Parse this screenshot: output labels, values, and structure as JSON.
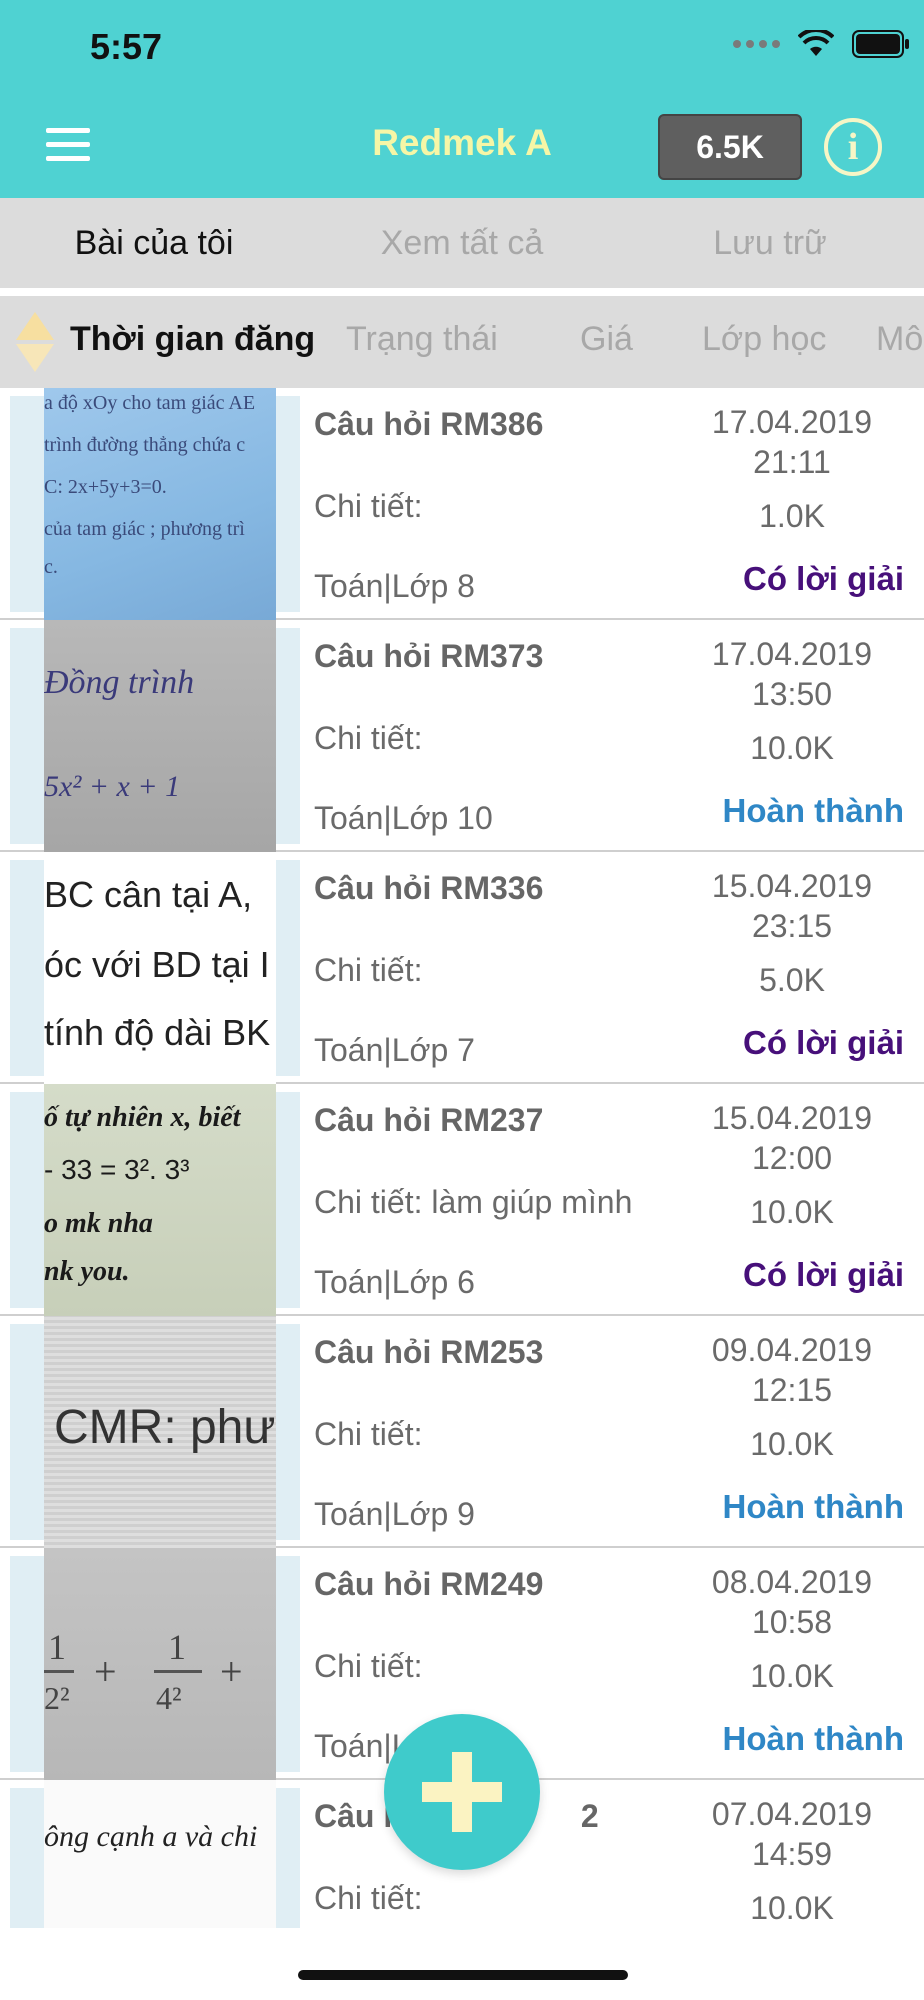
{
  "status_bar": {
    "time": "5:57"
  },
  "header": {
    "title": "Redmek A",
    "coins": "6.5K"
  },
  "tabs": [
    {
      "label": "Bài của tôi",
      "active": true
    },
    {
      "label": "Xem tất cả",
      "active": false
    },
    {
      "label": "Lưu trữ",
      "active": false
    }
  ],
  "sort_bar": {
    "items": [
      "Thời gian đăng",
      "Trạng thái",
      "Giá",
      "Lớp học",
      "Mô"
    ]
  },
  "questions": [
    {
      "title": "Câu hỏi RM386",
      "detail": "Chi tiết:",
      "subject": "Toán|Lớp 8",
      "date": "17.04.2019",
      "time": "21:11",
      "price": "1.0K",
      "status": "Có lời giải",
      "status_type": "solved",
      "thumb_text": [
        "a độ xOy cho tam giác AE",
        "trình đường thẳng chứa c",
        "C: 2x+5y+3=0.",
        "của tam giác ; phương trì",
        "c."
      ]
    },
    {
      "title": "Câu hỏi RM373",
      "detail": "Chi tiết:",
      "subject": "Toán|Lớp 10",
      "date": "17.04.2019",
      "time": "13:50",
      "price": "10.0K",
      "status": "Hoàn thành",
      "status_type": "done",
      "thumb_text": [
        "Đồng trình",
        "5x² + x + 1"
      ]
    },
    {
      "title": "Câu hỏi RM336",
      "detail": "Chi tiết:",
      "subject": "Toán|Lớp 7",
      "date": "15.04.2019",
      "time": "23:15",
      "price": "5.0K",
      "status": "Có lời giải",
      "status_type": "solved",
      "thumb_text": [
        "BC cân tại A,",
        "óc với BD tại I",
        "tính độ dài BK"
      ]
    },
    {
      "title": "Câu hỏi RM237",
      "detail": "Chi tiết: làm giúp mình",
      "subject": "Toán|Lớp 6",
      "date": "15.04.2019",
      "time": "12:00",
      "price": "10.0K",
      "status": "Có lời giải",
      "status_type": "solved",
      "thumb_text": [
        "ố tự nhiên x, biết",
        "- 33 = 3². 3³",
        "o mk nha",
        "nk you."
      ]
    },
    {
      "title": "Câu hỏi RM253",
      "detail": "Chi tiết:",
      "subject": "Toán|Lớp 9",
      "date": "09.04.2019",
      "time": "12:15",
      "price": "10.0K",
      "status": "Hoàn thành",
      "status_type": "done",
      "thumb_text": [
        "CMR: phư"
      ]
    },
    {
      "title": "Câu hỏi RM249",
      "detail": "Chi tiết:",
      "subject": "Toán|L",
      "date": "08.04.2019",
      "time": "10:58",
      "price": "10.0K",
      "status": "Hoàn thành",
      "status_type": "done",
      "thumb_text": [
        "1",
        "2²",
        "+",
        "1",
        "4²",
        "+"
      ]
    },
    {
      "title": "Câu h",
      "title_tail": "2",
      "detail": "Chi tiết:",
      "subject": "",
      "date": "07.04.2019",
      "time": "14:59",
      "price": "10.0K",
      "status": "",
      "status_type": "",
      "thumb_text": [
        "ông cạnh a và chi"
      ]
    }
  ],
  "colors": {
    "header_bg": "#4fd2d2",
    "title_color": "#f6f6a6",
    "tab_bar_bg": "#dcdcdc",
    "status_solved": "#47107a",
    "status_done": "#2f87c6",
    "fab_bg": "#3fcbcb"
  },
  "icons": [
    "menu-icon",
    "info-icon",
    "sort-arrows-icon",
    "wifi-icon",
    "battery-icon",
    "signal-icon",
    "add-icon"
  ]
}
